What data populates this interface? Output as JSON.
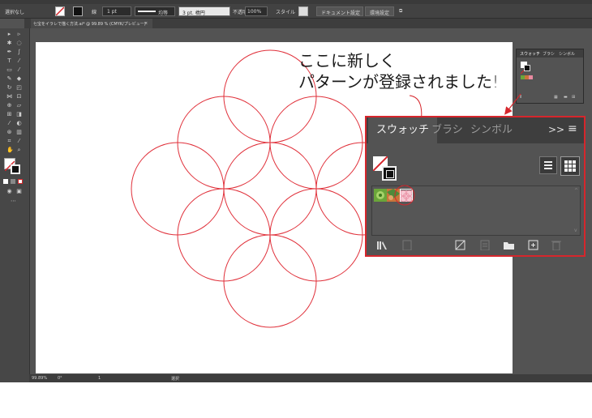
{
  "control_bar": {
    "selection_label": "選択なし",
    "stroke_label": "線",
    "stroke_weight": "1 pt",
    "brush_label": "均等",
    "brush_size": "3 pt. 楕円",
    "opacity_label": "不透明度",
    "opacity_value": "100%",
    "style_label": "スタイル",
    "doc_setup_button": "ドキュメント設定",
    "preferences_button": "環境設定"
  },
  "document_tab": {
    "title": "七宝をイラレで描く方法.ai* @ 99.89 % (CMYK/プレビュー)",
    "close": "×"
  },
  "status_bar": {
    "zoom": "99.89%",
    "rotation": "0°",
    "artboard": "1",
    "mode": "選択"
  },
  "small_panel": {
    "tabs": [
      "スウォッチ",
      "ブラシ",
      "シンボル"
    ]
  },
  "callout": {
    "line1": "ここに新しく",
    "line2": "パターンが登録されました!"
  },
  "swatches_panel": {
    "tabs": [
      "スウォッチ",
      "ブラシ",
      "シンボル"
    ],
    "active_tab": "スウォッチ",
    "overflow": ">>",
    "menu": "≡",
    "swatches": [
      {
        "name": "green-pattern",
        "color": "#6aa53a"
      },
      {
        "name": "orange-green-pattern",
        "color": "#c9743a"
      },
      {
        "name": "pink-pattern",
        "color": "#e98aa0"
      }
    ]
  },
  "colors": {
    "accent": "#d6262c",
    "pattern_stroke": "#e0303a",
    "ui_dark": "#535353"
  }
}
